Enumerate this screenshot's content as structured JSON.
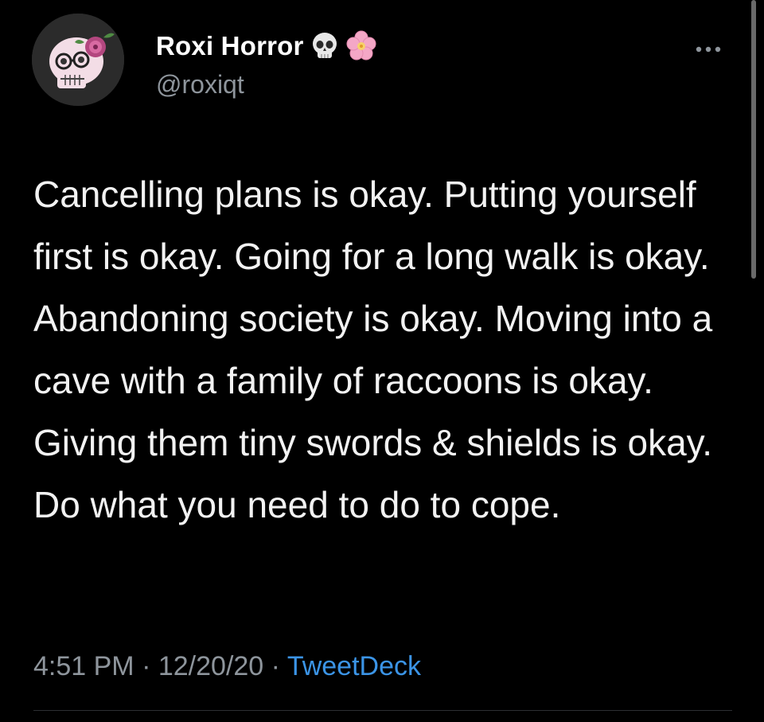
{
  "tweet": {
    "display_name": "Roxi Horror",
    "handle": "@roxiqt",
    "avatar": "skull-with-flower-avatar",
    "name_emojis": [
      "skull-icon",
      "cherry-blossom-icon"
    ],
    "text": "Cancelling plans is okay. Putting yourself first is okay. Going for a long walk is okay. Abandoning society is okay. Moving into a cave with a family of raccoons is okay. Giving them tiny swords & shields is okay. Do what you need to do to cope.",
    "time": "4:51 PM",
    "date": "12/20/20",
    "separator": "·",
    "source": "TweetDeck"
  },
  "colors": {
    "background": "#000000",
    "text": "#f2f2f2",
    "secondary_text": "#8e959c",
    "link": "#3b94e6"
  }
}
